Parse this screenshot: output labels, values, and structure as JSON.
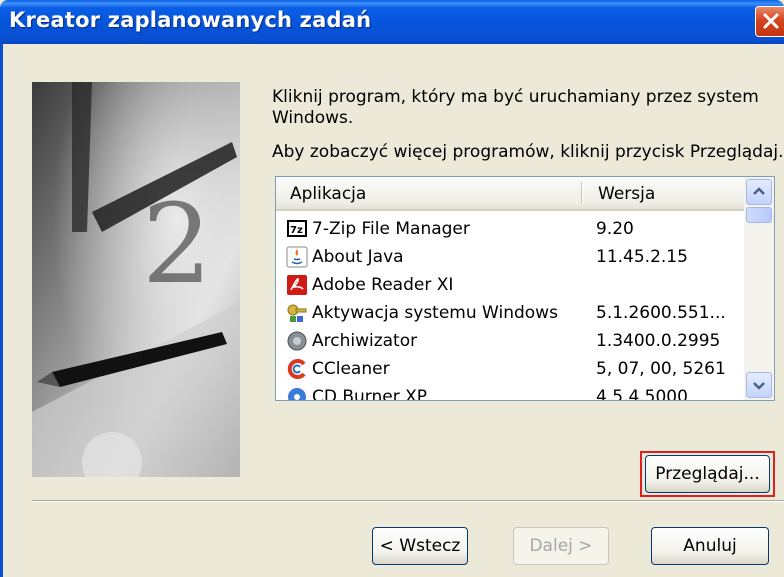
{
  "window": {
    "title": "Kreator zaplanowanych zadań"
  },
  "instructions": {
    "line1": "Kliknij program, który ma być uruchamiany przez system",
    "line2": "Windows.",
    "line3": "Aby zobaczyć więcej programów, kliknij przycisk Przeglądaj."
  },
  "list": {
    "columns": [
      "Aplikacja",
      "Wersja"
    ],
    "rows": [
      {
        "name": "7-Zip File Manager",
        "version": "9.20",
        "icon": "7zip-icon"
      },
      {
        "name": "About Java",
        "version": "11.45.2.15",
        "icon": "java-icon"
      },
      {
        "name": "Adobe Reader XI",
        "version": "",
        "icon": "adobe-reader-icon"
      },
      {
        "name": "Aktywacja systemu Windows",
        "version": "5.1.2600.551...",
        "icon": "windows-activation-icon"
      },
      {
        "name": "Archiwizator",
        "version": "1.3400.0.2995",
        "icon": "archiver-icon"
      },
      {
        "name": "CCleaner",
        "version": "5, 07, 00, 5261",
        "icon": "ccleaner-icon"
      },
      {
        "name": "CD Burner XP",
        "version": "4.5.4.5000",
        "icon": "cdburner-icon"
      }
    ]
  },
  "buttons": {
    "browse": "Przeglądaj...",
    "back": "< Wstecz",
    "next": "Dalej >",
    "cancel": "Anuluj"
  },
  "colors": {
    "titlebar": "#0553d9",
    "close": "#d5451f",
    "highlight": "#e02020",
    "dialog_bg": "#ece9d8"
  }
}
